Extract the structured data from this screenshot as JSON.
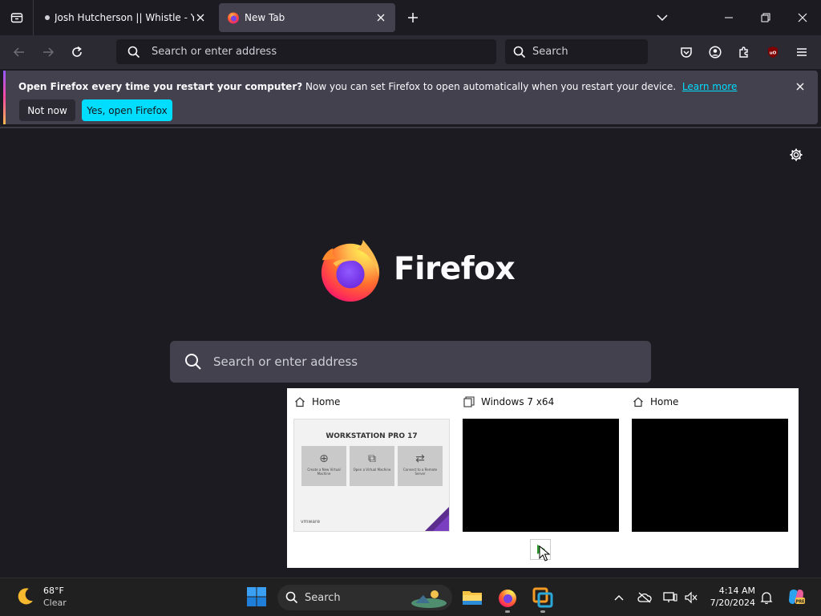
{
  "browser": {
    "tabs": [
      {
        "title": "Josh Hutcherson || Whistle - Yo",
        "active": false
      },
      {
        "title": "New Tab",
        "active": true
      }
    ],
    "urlbar_placeholder": "Search or enter address",
    "searchbar_placeholder": "Search",
    "notification": {
      "bold": "Open Firefox every time you restart your computer?",
      "text": "Now you can set Firefox to open automatically when you restart your device.",
      "link": "Learn more",
      "secondary_button": "Not now",
      "primary_button": "Yes, open Firefox"
    },
    "newtab": {
      "wordmark": "Firefox",
      "search_placeholder": "Search or enter address"
    },
    "colors": {
      "accent": "#00ddff",
      "chrome_bg": "#2b2a33",
      "page_bg": "#1c1b22"
    }
  },
  "thumbnails": [
    {
      "title": "Home",
      "icon": "home-icon",
      "preview": "vmware"
    },
    {
      "title": "Windows 7 x64",
      "icon": "window-icon",
      "preview": "black"
    },
    {
      "title": "Home",
      "icon": "home-icon",
      "preview": "black"
    }
  ],
  "vmware_preview": {
    "heading": "WORKSTATION PRO 17",
    "cards": [
      "Create a New Virtual Machine",
      "Open a Virtual Machine",
      "Connect to a Remote Server"
    ],
    "brand": "vmware"
  },
  "taskbar": {
    "weather_temp": "68°F",
    "weather_desc": "Clear",
    "search_label": "Search",
    "time": "4:14 AM",
    "date": "7/20/2024"
  }
}
